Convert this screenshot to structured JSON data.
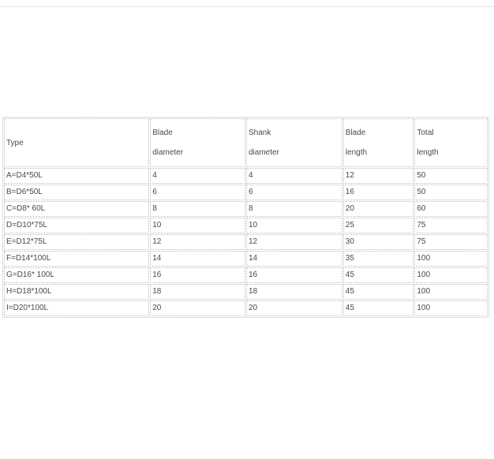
{
  "table": {
    "headers": [
      [
        "Type"
      ],
      [
        "Blade",
        "diameter"
      ],
      [
        "Shank",
        "diameter"
      ],
      [
        "Blade",
        "length"
      ],
      [
        "Total",
        "length"
      ]
    ],
    "rows": [
      [
        "A=D4*50L",
        "4",
        "4",
        "12",
        "50"
      ],
      [
        "B=D6*50L",
        "6",
        "6",
        "16",
        "50"
      ],
      [
        "C=D8* 60L",
        "8",
        "8",
        "20",
        "60"
      ],
      [
        "D=D10*75L",
        "10",
        "10",
        "25",
        "75"
      ],
      [
        "E=D12*75L",
        "12",
        "12",
        "30",
        "75"
      ],
      [
        "F=D14*100L",
        "14",
        "14",
        "35",
        "100"
      ],
      [
        "G=D16* 100L",
        "16",
        "16",
        "45",
        "100"
      ],
      [
        "H=D18*100L",
        "18",
        "18",
        "45",
        "100"
      ],
      [
        "I=D20*100L",
        "20",
        "20",
        "45",
        "100"
      ]
    ]
  }
}
